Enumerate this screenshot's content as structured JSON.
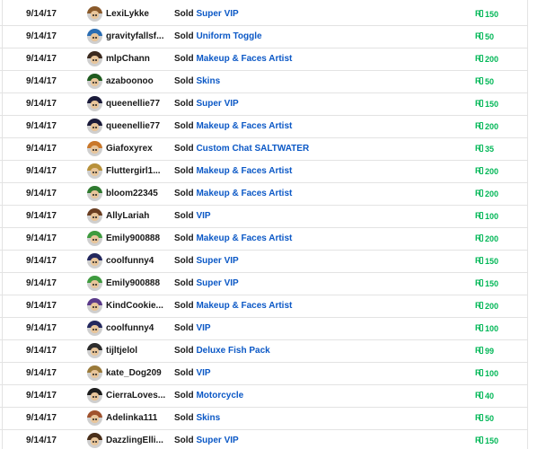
{
  "sales": [
    {
      "date": "9/14/17",
      "user": "LexiLykke",
      "avatar_icon": "avatar-icon",
      "avatar_hair": "#8a5a2b",
      "action": "Sold",
      "item": "Super VIP",
      "price": "150",
      "currency_icon": "robux-icon"
    },
    {
      "date": "9/14/17",
      "user": "gravityfallsf...",
      "avatar_icon": "avatar-icon",
      "avatar_hair": "#2a6db3",
      "action": "Sold",
      "item": "Uniform Toggle",
      "price": "50",
      "currency_icon": "robux-icon"
    },
    {
      "date": "9/14/17",
      "user": "mlpChann",
      "avatar_icon": "avatar-icon",
      "avatar_hair": "#3b2a1f",
      "action": "Sold",
      "item": "Makeup & Faces Artist",
      "price": "200",
      "currency_icon": "robux-icon"
    },
    {
      "date": "9/14/17",
      "user": "azaboonoo",
      "avatar_icon": "avatar-icon",
      "avatar_hair": "#1f5b1f",
      "action": "Sold",
      "item": "Skins",
      "price": "50",
      "currency_icon": "robux-icon"
    },
    {
      "date": "9/14/17",
      "user": "queenellie77",
      "avatar_icon": "avatar-icon",
      "avatar_hair": "#1b1b3a",
      "action": "Sold",
      "item": "Super VIP",
      "price": "150",
      "currency_icon": "robux-icon"
    },
    {
      "date": "9/14/17",
      "user": "queenellie77",
      "avatar_icon": "avatar-icon",
      "avatar_hair": "#1b1b3a",
      "action": "Sold",
      "item": "Makeup & Faces Artist",
      "price": "200",
      "currency_icon": "robux-icon"
    },
    {
      "date": "9/14/17",
      "user": "Giafoxyrex",
      "avatar_icon": "avatar-icon",
      "avatar_hair": "#c9782b",
      "action": "Sold",
      "item": "Custom Chat SALTWATER",
      "price": "35",
      "currency_icon": "robux-icon"
    },
    {
      "date": "9/14/17",
      "user": "Fluttergirl1...",
      "avatar_icon": "avatar-icon",
      "avatar_hair": "#b8913a",
      "action": "Sold",
      "item": "Makeup & Faces Artist",
      "price": "200",
      "currency_icon": "robux-icon"
    },
    {
      "date": "9/14/17",
      "user": "bloom22345",
      "avatar_icon": "avatar-icon",
      "avatar_hair": "#2f7a2f",
      "action": "Sold",
      "item": "Makeup & Faces Artist",
      "price": "200",
      "currency_icon": "robux-icon"
    },
    {
      "date": "9/14/17",
      "user": "AllyLariah",
      "avatar_icon": "avatar-icon",
      "avatar_hair": "#6b3f22",
      "action": "Sold",
      "item": "VIP",
      "price": "100",
      "currency_icon": "robux-icon"
    },
    {
      "date": "9/14/17",
      "user": "Emily900888",
      "avatar_icon": "avatar-icon",
      "avatar_hair": "#3f9b3f",
      "action": "Sold",
      "item": "Makeup & Faces Artist",
      "price": "200",
      "currency_icon": "robux-icon"
    },
    {
      "date": "9/14/17",
      "user": "coolfunny4",
      "avatar_icon": "avatar-icon",
      "avatar_hair": "#23285e",
      "action": "Sold",
      "item": "Super VIP",
      "price": "150",
      "currency_icon": "robux-icon"
    },
    {
      "date": "9/14/17",
      "user": "Emily900888",
      "avatar_icon": "avatar-icon",
      "avatar_hair": "#3f9b3f",
      "action": "Sold",
      "item": "Super VIP",
      "price": "150",
      "currency_icon": "robux-icon"
    },
    {
      "date": "9/14/17",
      "user": "KindCookie...",
      "avatar_icon": "avatar-icon",
      "avatar_hair": "#5b3a8a",
      "action": "Sold",
      "item": "Makeup & Faces Artist",
      "price": "200",
      "currency_icon": "robux-icon"
    },
    {
      "date": "9/14/17",
      "user": "coolfunny4",
      "avatar_icon": "avatar-icon",
      "avatar_hair": "#23285e",
      "action": "Sold",
      "item": "VIP",
      "price": "100",
      "currency_icon": "robux-icon"
    },
    {
      "date": "9/14/17",
      "user": "tijltjelol",
      "avatar_icon": "avatar-icon",
      "avatar_hair": "#2e2e2e",
      "action": "Sold",
      "item": "Deluxe Fish Pack",
      "price": "99",
      "currency_icon": "robux-icon"
    },
    {
      "date": "9/14/17",
      "user": "kate_Dog209",
      "avatar_icon": "avatar-icon",
      "avatar_hair": "#9a7a3a",
      "action": "Sold",
      "item": "VIP",
      "price": "100",
      "currency_icon": "robux-icon"
    },
    {
      "date": "9/14/17",
      "user": "CierraLoves...",
      "avatar_icon": "avatar-icon",
      "avatar_hair": "#1e1e1e",
      "action": "Sold",
      "item": "Motorcycle",
      "price": "40",
      "currency_icon": "robux-icon"
    },
    {
      "date": "9/14/17",
      "user": "Adelinka111",
      "avatar_icon": "avatar-icon",
      "avatar_hair": "#a0522d",
      "action": "Sold",
      "item": "Skins",
      "price": "50",
      "currency_icon": "robux-icon"
    },
    {
      "date": "9/14/17",
      "user": "DazzlingElli...",
      "avatar_icon": "avatar-icon",
      "avatar_hair": "#4a2f1a",
      "action": "Sold",
      "item": "Super VIP",
      "price": "150",
      "currency_icon": "robux-icon"
    }
  ],
  "colors": {
    "link": "#0b58c6",
    "robux_green": "#02b757",
    "text": "#191919",
    "divider": "#e3e3e3"
  }
}
